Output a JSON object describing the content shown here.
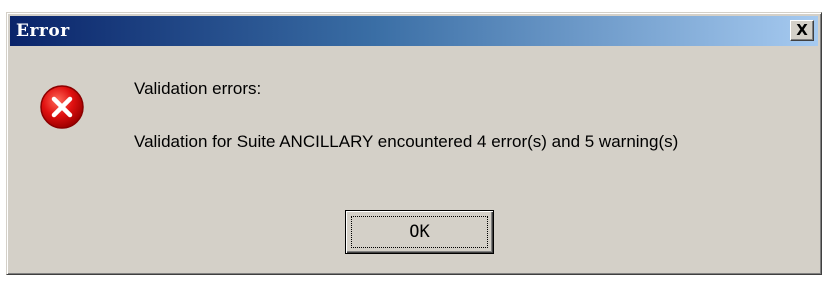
{
  "window": {
    "title": "Error",
    "close_glyph": "X"
  },
  "icon": {
    "name": "error-icon",
    "glyph": "✕",
    "color": "#e01010"
  },
  "message": {
    "heading": "Validation errors:",
    "body": "Validation for Suite ANCILLARY encountered 4 error(s) and 5 warning(s)"
  },
  "buttons": {
    "ok_label": "OK"
  },
  "colors": {
    "face": "#d4d0c8",
    "title_start": "#0a246a",
    "title_end": "#a6caf0"
  }
}
